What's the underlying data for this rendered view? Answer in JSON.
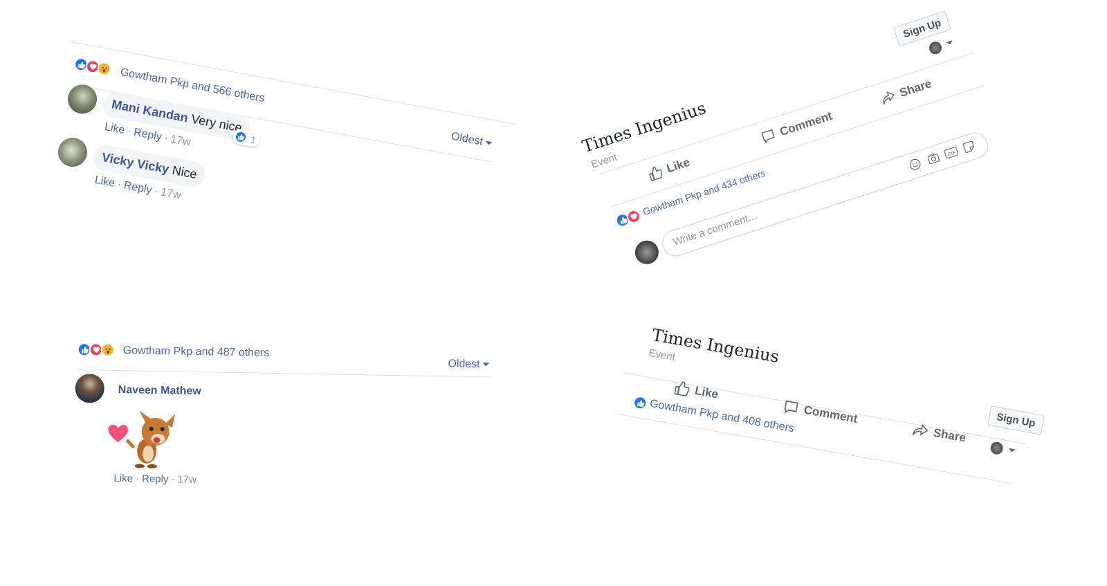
{
  "colors": {
    "link": "#4267b2",
    "name": "#385898",
    "meta": "#90949c",
    "like": "#1877f2",
    "love": "#f33e58",
    "wow": "#f7b125",
    "divider": "#dddfe2"
  },
  "panel_top_left": {
    "summary": "Gowtham Pkp and 566 others",
    "reactions": [
      "like-icon",
      "love-icon",
      "wow-icon"
    ],
    "sort_label": "Oldest",
    "comments": [
      {
        "author": "Mani Kandan",
        "text": "Very nice",
        "like_count": "1",
        "actions": {
          "like": "Like",
          "reply": "Reply",
          "time": "17w"
        }
      },
      {
        "author": "Vicky Vicky",
        "text": "Nice",
        "actions": {
          "like": "Like",
          "reply": "Reply",
          "time": "17w"
        }
      }
    ]
  },
  "panel_top_right": {
    "title": "Times Ingenius",
    "subtitle": "Event",
    "signup_label": "Sign Up",
    "buttons": {
      "like": "Like",
      "comment": "Comment",
      "share": "Share"
    },
    "summary": "Gowtham Pkp and 434 others",
    "reactions": [
      "like-icon",
      "love-icon"
    ],
    "comment_placeholder": "Write a comment...",
    "comment_tools": [
      "emoji-icon",
      "camera-icon",
      "gif-icon",
      "sticker-icon"
    ]
  },
  "panel_bottom_left": {
    "summary": "Gowtham Pkp and 487 others",
    "reactions": [
      "like-icon",
      "love-icon",
      "wow-icon"
    ],
    "sort_label": "Oldest",
    "comment": {
      "author": "Naveen Mathew",
      "sticker": "dog-heart-sticker",
      "actions": {
        "like": "Like",
        "reply": "Reply",
        "time": "17w"
      }
    }
  },
  "panel_bottom_right": {
    "title": "Times Ingenius",
    "subtitle": "Event",
    "signup_label": "Sign Up",
    "buttons": {
      "like": "Like",
      "comment": "Comment",
      "share": "Share"
    },
    "summary": "Gowtham Pkp and 408 others",
    "reactions": [
      "like-icon"
    ]
  }
}
